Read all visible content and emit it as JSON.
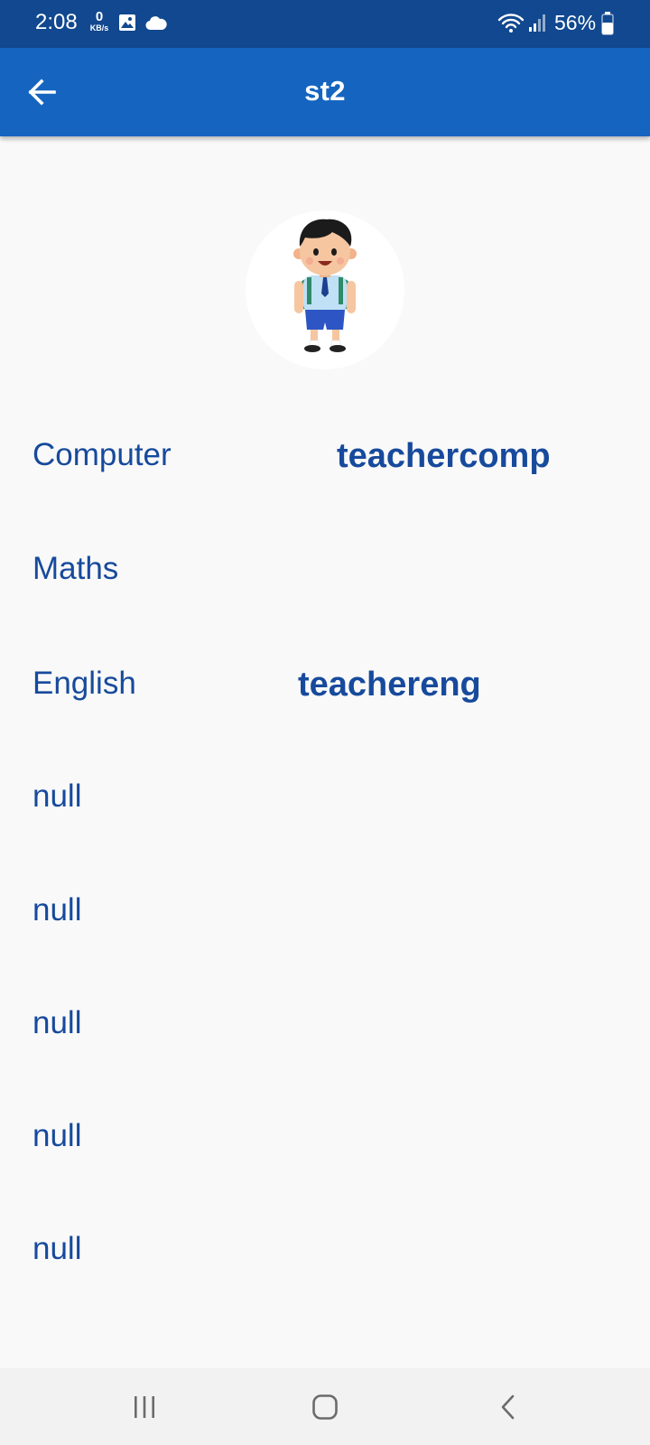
{
  "status_bar": {
    "time": "2:08",
    "net_speed_value": "0",
    "net_speed_unit": "KB/s",
    "battery_percent": "56%"
  },
  "app_bar": {
    "title": "st2"
  },
  "subjects": [
    {
      "subject": "Computer",
      "teacher": "teachercomp"
    },
    {
      "subject": "Maths",
      "teacher": ""
    },
    {
      "subject": "English",
      "teacher": "teachereng"
    },
    {
      "subject": "null",
      "teacher": ""
    },
    {
      "subject": "null",
      "teacher": ""
    },
    {
      "subject": "null",
      "teacher": ""
    },
    {
      "subject": "null",
      "teacher": ""
    },
    {
      "subject": "null",
      "teacher": ""
    }
  ],
  "icons": {
    "back": "arrow-left-icon",
    "avatar": "student-boy-illustration",
    "nav_recents": "recent-apps-icon",
    "nav_home": "home-icon",
    "nav_back": "back-chevron-icon"
  },
  "colors": {
    "status_bar": "#11488f",
    "app_bar": "#1565c0",
    "text_primary": "#174a9c",
    "background": "#f9f9f9",
    "nav_bar": "#f2f2f2"
  }
}
